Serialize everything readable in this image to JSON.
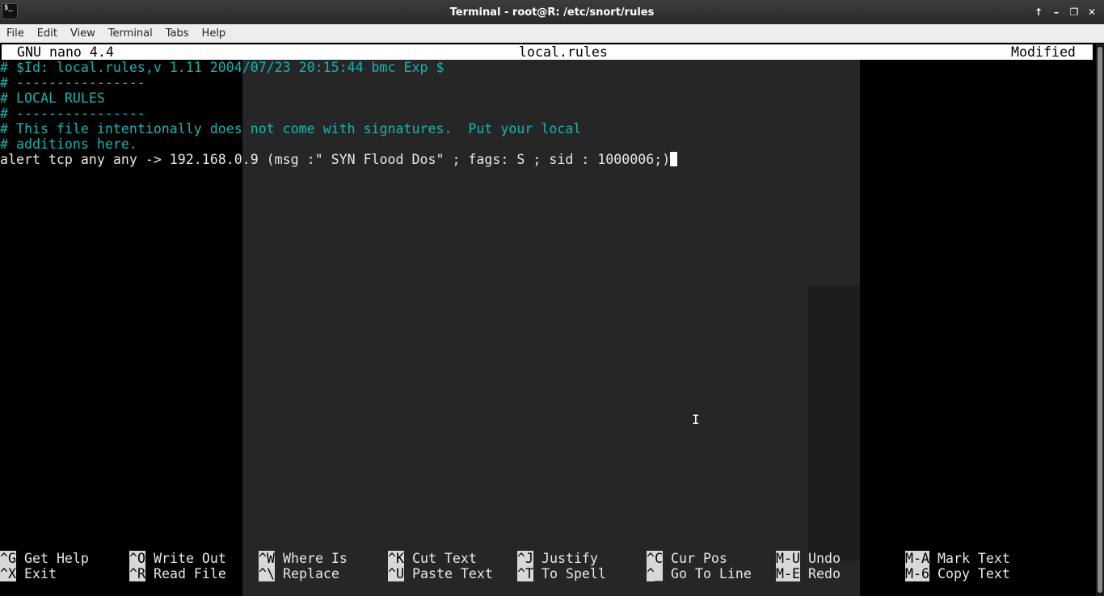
{
  "window": {
    "title": "Terminal - root@R: /etc/snort/rules",
    "app_icon_text": "$_",
    "buttons": [
      "arrow-up-icon",
      "minimize-icon",
      "maximize-icon",
      "close-icon"
    ]
  },
  "menubar": {
    "items": [
      "File",
      "Edit",
      "View",
      "Terminal",
      "Tabs",
      "Help"
    ]
  },
  "nano": {
    "version": "GNU nano 4.4",
    "filename": "local.rules",
    "status": "Modified"
  },
  "editor": {
    "lines": [
      "# $Id: local.rules,v 1.11 2004/07/23 20:15:44 bmc Exp $",
      "# ----------------",
      "# LOCAL RULES",
      "# ----------------",
      "# This file intentionally does not come with signatures.  Put your local",
      "# additions here.",
      "alert tcp any any -> 192.168.0.9 (msg :\" SYN Flood Dos\" ; fags: S ; sid : 1000006;)"
    ]
  },
  "shortcuts": {
    "row1": [
      {
        "key": "^G",
        "label": "Get Help"
      },
      {
        "key": "^O",
        "label": "Write Out"
      },
      {
        "key": "^W",
        "label": "Where Is"
      },
      {
        "key": "^K",
        "label": "Cut Text"
      },
      {
        "key": "^J",
        "label": "Justify"
      },
      {
        "key": "^C",
        "label": "Cur Pos"
      },
      {
        "key": "M-U",
        "label": "Undo"
      },
      {
        "key": "M-A",
        "label": "Mark Text"
      }
    ],
    "row2": [
      {
        "key": "^X",
        "label": "Exit"
      },
      {
        "key": "^R",
        "label": "Read File"
      },
      {
        "key": "^\\",
        "label": "Replace"
      },
      {
        "key": "^U",
        "label": "Paste Text"
      },
      {
        "key": "^T",
        "label": "To Spell"
      },
      {
        "key": "^_",
        "label": "Go To Line"
      },
      {
        "key": "M-E",
        "label": "Redo"
      },
      {
        "key": "M-6",
        "label": "Copy Text"
      }
    ]
  },
  "colors": {
    "comment": "#19b3b3",
    "header_bg": "#ffffff"
  }
}
